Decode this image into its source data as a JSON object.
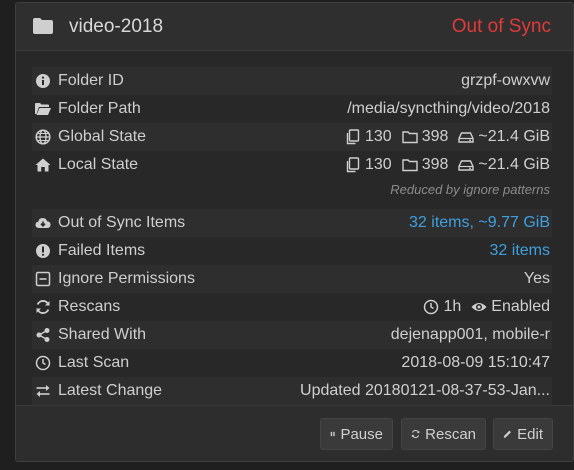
{
  "header": {
    "icon": "folder-icon",
    "title": "video-2018",
    "status": "Out of Sync",
    "status_color": "#e03a3a"
  },
  "rows": {
    "folder_id": {
      "label": "Folder ID",
      "value": "grzpf-owxvw"
    },
    "folder_path": {
      "label": "Folder Path",
      "value": "/media/syncthing/video/2018"
    },
    "global_state": {
      "label": "Global State",
      "files": "130",
      "dirs": "398",
      "size": "~21.4 GiB"
    },
    "local_state": {
      "label": "Local State",
      "files": "130",
      "dirs": "398",
      "size": "~21.4 GiB"
    },
    "local_note": "Reduced by ignore patterns",
    "out_of_sync": {
      "label": "Out of Sync Items",
      "value": "32 items, ~9.77 GiB"
    },
    "failed": {
      "label": "Failed Items",
      "value": "32 items"
    },
    "ignore_perms": {
      "label": "Ignore Permissions",
      "value": "Yes"
    },
    "rescans": {
      "label": "Rescans",
      "interval": "1h",
      "watch": "Enabled"
    },
    "shared_with": {
      "label": "Shared With",
      "value": "dejenapp001, mobile-r"
    },
    "last_scan": {
      "label": "Last Scan",
      "value": "2018-08-09 15:10:47"
    },
    "latest_change": {
      "label": "Latest Change",
      "value": "Updated 20180121-08-37-53-Jan..."
    }
  },
  "buttons": {
    "pause": "Pause",
    "rescan": "Rescan",
    "edit": "Edit"
  },
  "colors": {
    "link": "#3fa0e0",
    "background": "#1f1f1f",
    "panel": "#282828"
  }
}
